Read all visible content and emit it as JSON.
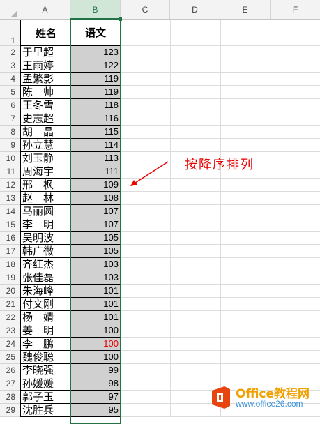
{
  "columns": [
    "A",
    "B",
    "C",
    "D",
    "E",
    "F"
  ],
  "header": {
    "name": "姓名",
    "score": "语文"
  },
  "rows": [
    {
      "num": "2",
      "name": "于里超",
      "score": "123"
    },
    {
      "num": "3",
      "name": "王雨婷",
      "score": "122"
    },
    {
      "num": "4",
      "name": "孟繁影",
      "score": "119"
    },
    {
      "num": "5",
      "name": "陈　帅",
      "score": "119"
    },
    {
      "num": "6",
      "name": "王冬雪",
      "score": "118"
    },
    {
      "num": "7",
      "name": "史志超",
      "score": "116"
    },
    {
      "num": "8",
      "name": "胡　晶",
      "score": "115"
    },
    {
      "num": "9",
      "name": "孙立慧",
      "score": "114"
    },
    {
      "num": "10",
      "name": "刘玉静",
      "score": "113"
    },
    {
      "num": "11",
      "name": "周海宇",
      "score": "111"
    },
    {
      "num": "12",
      "name": "邢　枫",
      "score": "109"
    },
    {
      "num": "13",
      "name": "赵　林",
      "score": "108"
    },
    {
      "num": "14",
      "name": "马丽圆",
      "score": "107"
    },
    {
      "num": "15",
      "name": "李　明",
      "score": "107"
    },
    {
      "num": "16",
      "name": "吴明波",
      "score": "105"
    },
    {
      "num": "17",
      "name": "韩广微",
      "score": "105"
    },
    {
      "num": "18",
      "name": "齐红杰",
      "score": "103"
    },
    {
      "num": "19",
      "name": "张佳磊",
      "score": "103"
    },
    {
      "num": "20",
      "name": "朱海峰",
      "score": "101"
    },
    {
      "num": "21",
      "name": "付文刚",
      "score": "101"
    },
    {
      "num": "22",
      "name": "杨　婧",
      "score": "101"
    },
    {
      "num": "23",
      "name": "姜　明",
      "score": "100"
    },
    {
      "num": "24",
      "name": "李　鹏",
      "score": "100",
      "highlight": "#e60000"
    },
    {
      "num": "25",
      "name": "魏俊聪",
      "score": "100"
    },
    {
      "num": "26",
      "name": "李晓强",
      "score": "99"
    },
    {
      "num": "27",
      "name": "孙媛媛",
      "score": "98"
    },
    {
      "num": "28",
      "name": "郭子玉",
      "score": "97"
    },
    {
      "num": "29",
      "name": "沈胜兵",
      "score": "95"
    }
  ],
  "header_row_num": "1",
  "annotation": "按降序排列",
  "logo": {
    "title": "Office教程网",
    "url": "www.office26.com"
  },
  "colors": {
    "selection": "#217346",
    "annotation": "#e60000",
    "score_fill": "#d0d0d0"
  }
}
